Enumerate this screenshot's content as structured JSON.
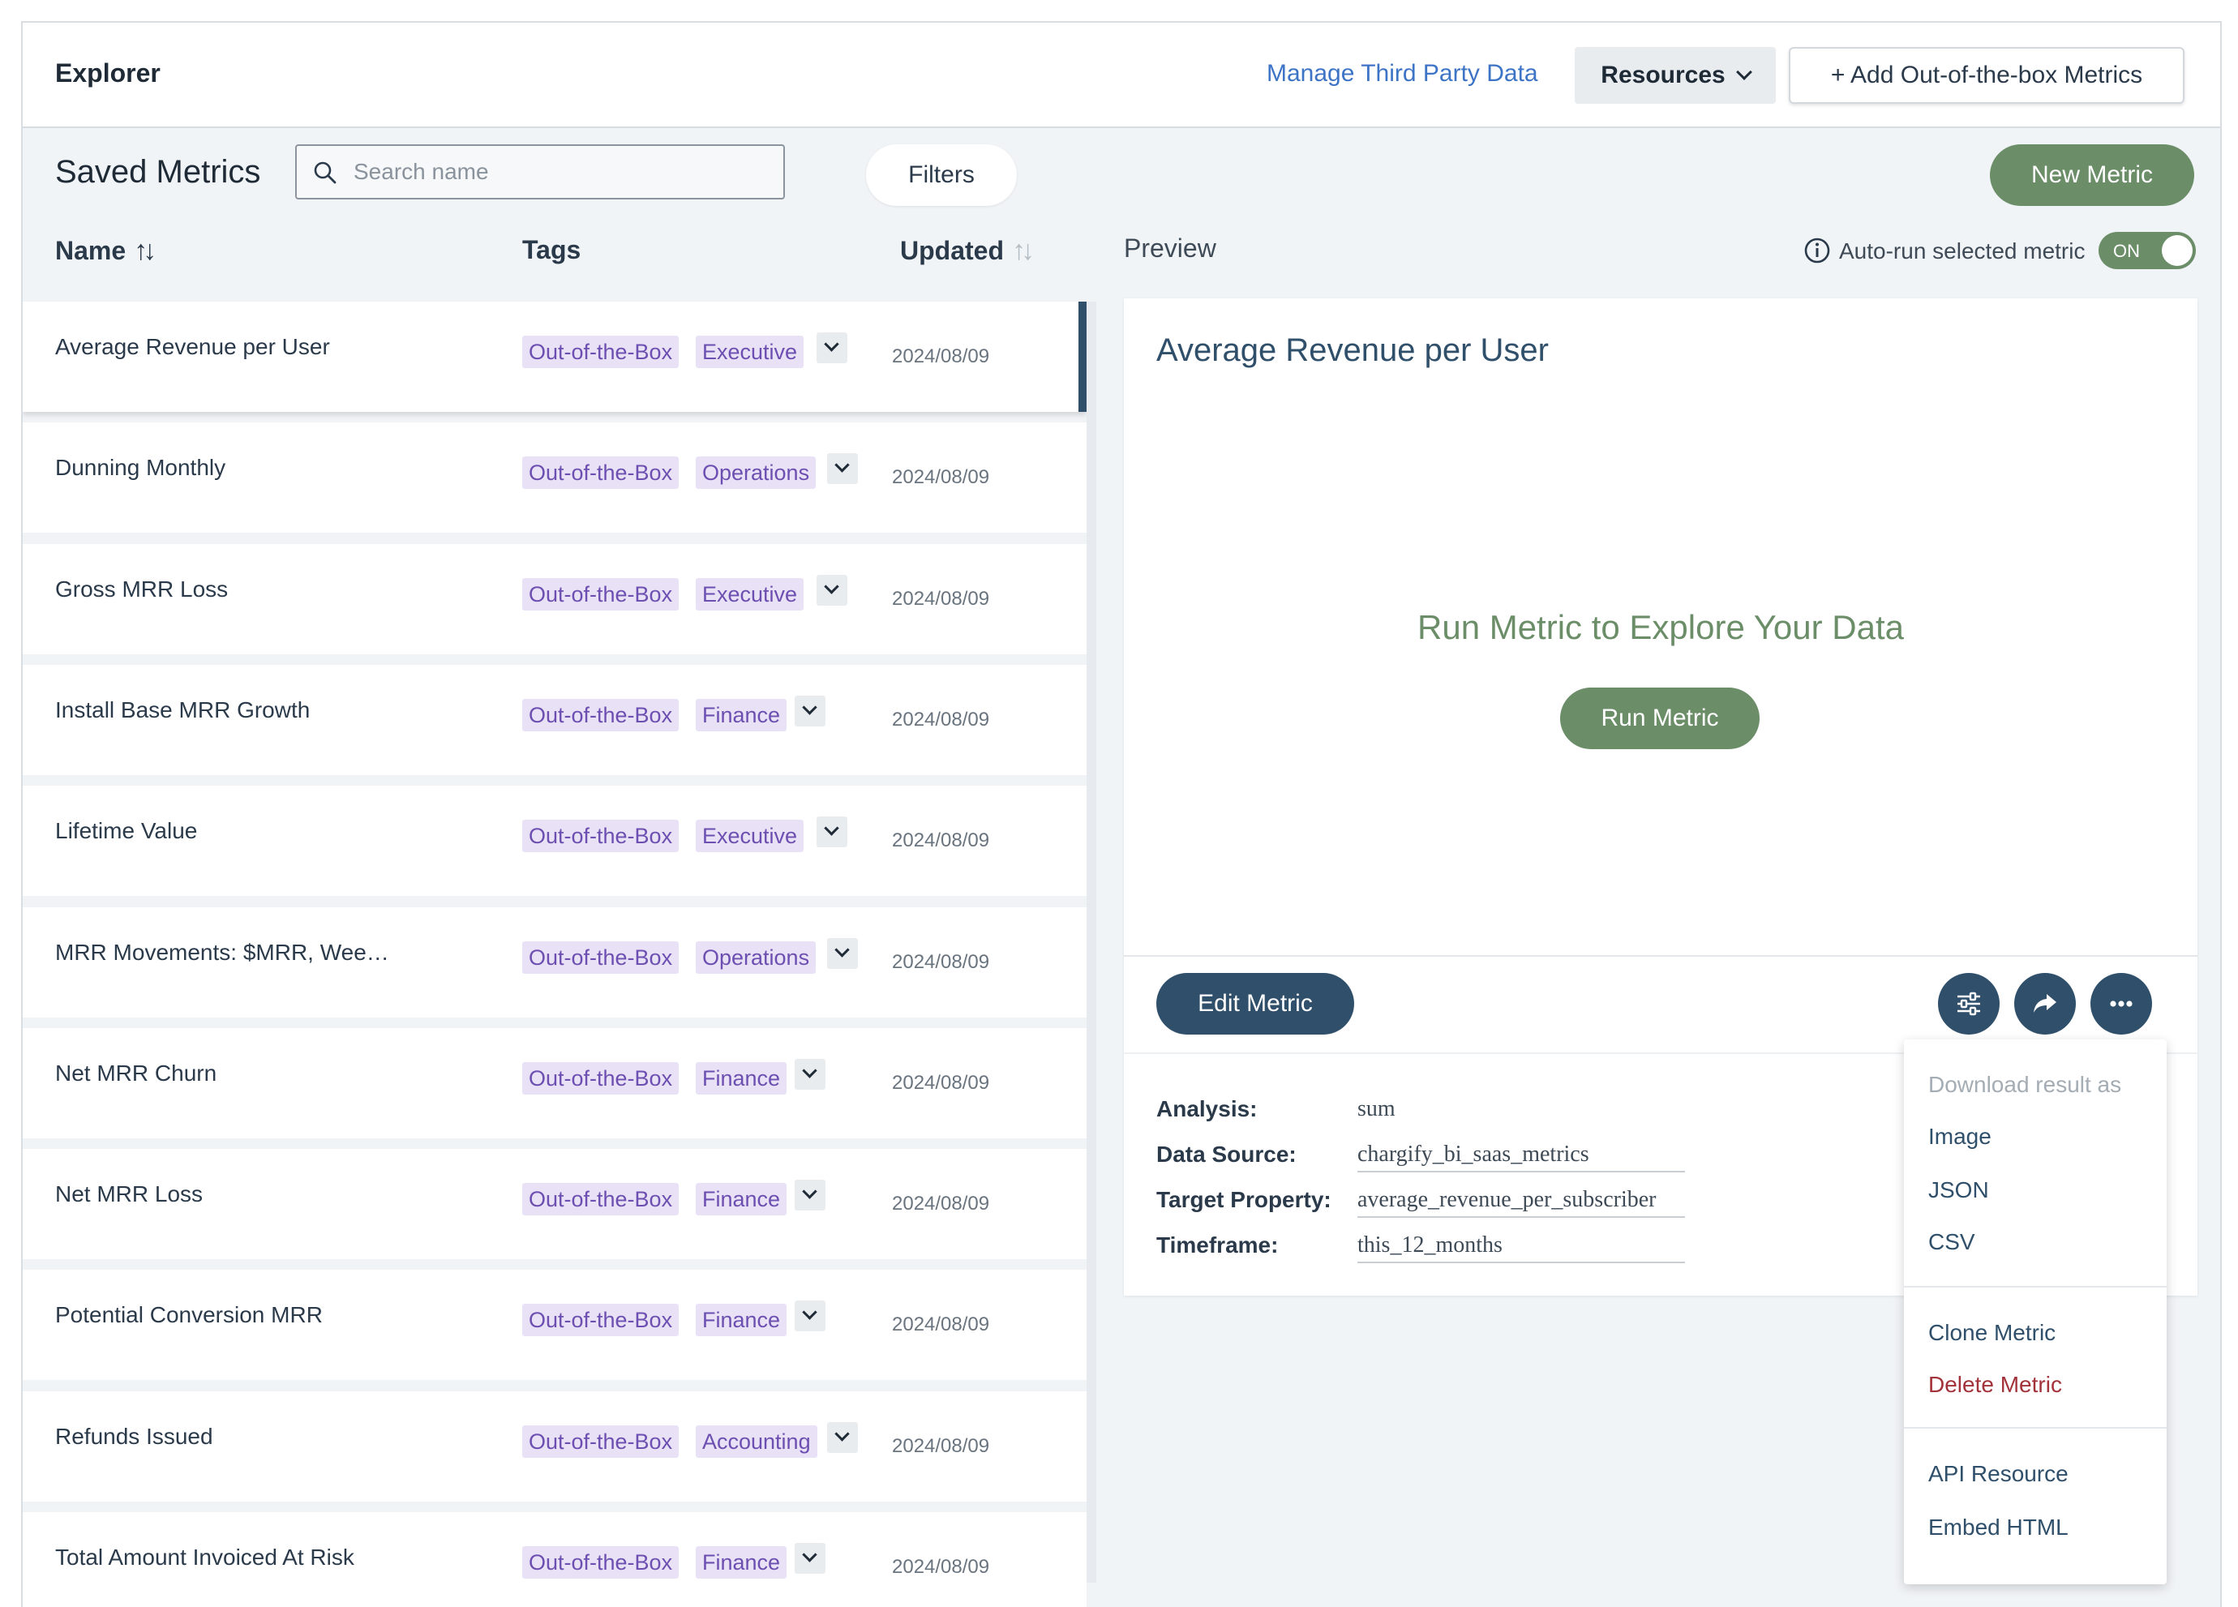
{
  "header": {
    "title": "Explorer",
    "manage_link": "Manage Third Party Data",
    "resources_label": "Resources",
    "add_metrics_label": "+ Add Out-of-the-box Metrics"
  },
  "saved": {
    "title": "Saved Metrics",
    "search_placeholder": "Search name",
    "filters_label": "Filters",
    "new_metric_label": "New Metric"
  },
  "columns": {
    "name": "Name",
    "tags": "Tags",
    "updated": "Updated"
  },
  "metrics": [
    {
      "name": "Average Revenue per User",
      "tags": [
        "Out-of-the-Box",
        "Executive"
      ],
      "updated": "2024/08/09",
      "selected": true
    },
    {
      "name": "Dunning Monthly",
      "tags": [
        "Out-of-the-Box",
        "Operations"
      ],
      "updated": "2024/08/09"
    },
    {
      "name": "Gross MRR Loss",
      "tags": [
        "Out-of-the-Box",
        "Executive"
      ],
      "updated": "2024/08/09"
    },
    {
      "name": "Install Base MRR Growth",
      "tags": [
        "Out-of-the-Box",
        "Finance"
      ],
      "updated": "2024/08/09"
    },
    {
      "name": "Lifetime Value",
      "tags": [
        "Out-of-the-Box",
        "Executive"
      ],
      "updated": "2024/08/09"
    },
    {
      "name": "MRR Movements: $MRR, Wee…",
      "tags": [
        "Out-of-the-Box",
        "Operations"
      ],
      "updated": "2024/08/09"
    },
    {
      "name": "Net MRR Churn",
      "tags": [
        "Out-of-the-Box",
        "Finance"
      ],
      "updated": "2024/08/09"
    },
    {
      "name": "Net MRR Loss",
      "tags": [
        "Out-of-the-Box",
        "Finance"
      ],
      "updated": "2024/08/09"
    },
    {
      "name": "Potential Conversion MRR",
      "tags": [
        "Out-of-the-Box",
        "Finance"
      ],
      "updated": "2024/08/09"
    },
    {
      "name": "Refunds Issued",
      "tags": [
        "Out-of-the-Box",
        "Accounting"
      ],
      "updated": "2024/08/09"
    },
    {
      "name": "Total Amount Invoiced At Risk",
      "tags": [
        "Out-of-the-Box",
        "Finance"
      ],
      "updated": "2024/08/09"
    }
  ],
  "preview": {
    "label": "Preview",
    "autorun_label": "Auto-run selected metric",
    "toggle_state": "ON",
    "metric_title": "Average Revenue per User",
    "empty_message": "Run Metric to Explore Your Data",
    "run_label": "Run Metric",
    "edit_label": "Edit Metric",
    "properties": {
      "analysis_label": "Analysis:",
      "analysis_value": "sum",
      "source_label": "Data Source:",
      "source_value": "chargify_bi_saas_metrics",
      "target_label": "Target Property:",
      "target_value": "average_revenue_per_subscriber",
      "timeframe_label": "Timeframe:",
      "timeframe_value": "this_12_months"
    }
  },
  "menu": {
    "download_header": "Download result as",
    "image": "Image",
    "json": "JSON",
    "csv": "CSV",
    "clone": "Clone Metric",
    "delete": "Delete Metric",
    "api": "API Resource",
    "embed": "Embed HTML"
  },
  "colors": {
    "accent_green": "#6b8e69",
    "navy": "#2f4f6a",
    "tag_bg": "#e9e2f7",
    "tag_text": "#6c4fb0",
    "link_blue": "#3d74c6",
    "danger": "#a3323a"
  },
  "icons": {
    "search": "search-icon",
    "sort": "sort-arrows-icon",
    "info": "info-icon",
    "settings": "sliders-icon",
    "share": "share-arrow-icon",
    "more": "ellipsis-icon",
    "dropdown": "chevron-down-icon"
  }
}
